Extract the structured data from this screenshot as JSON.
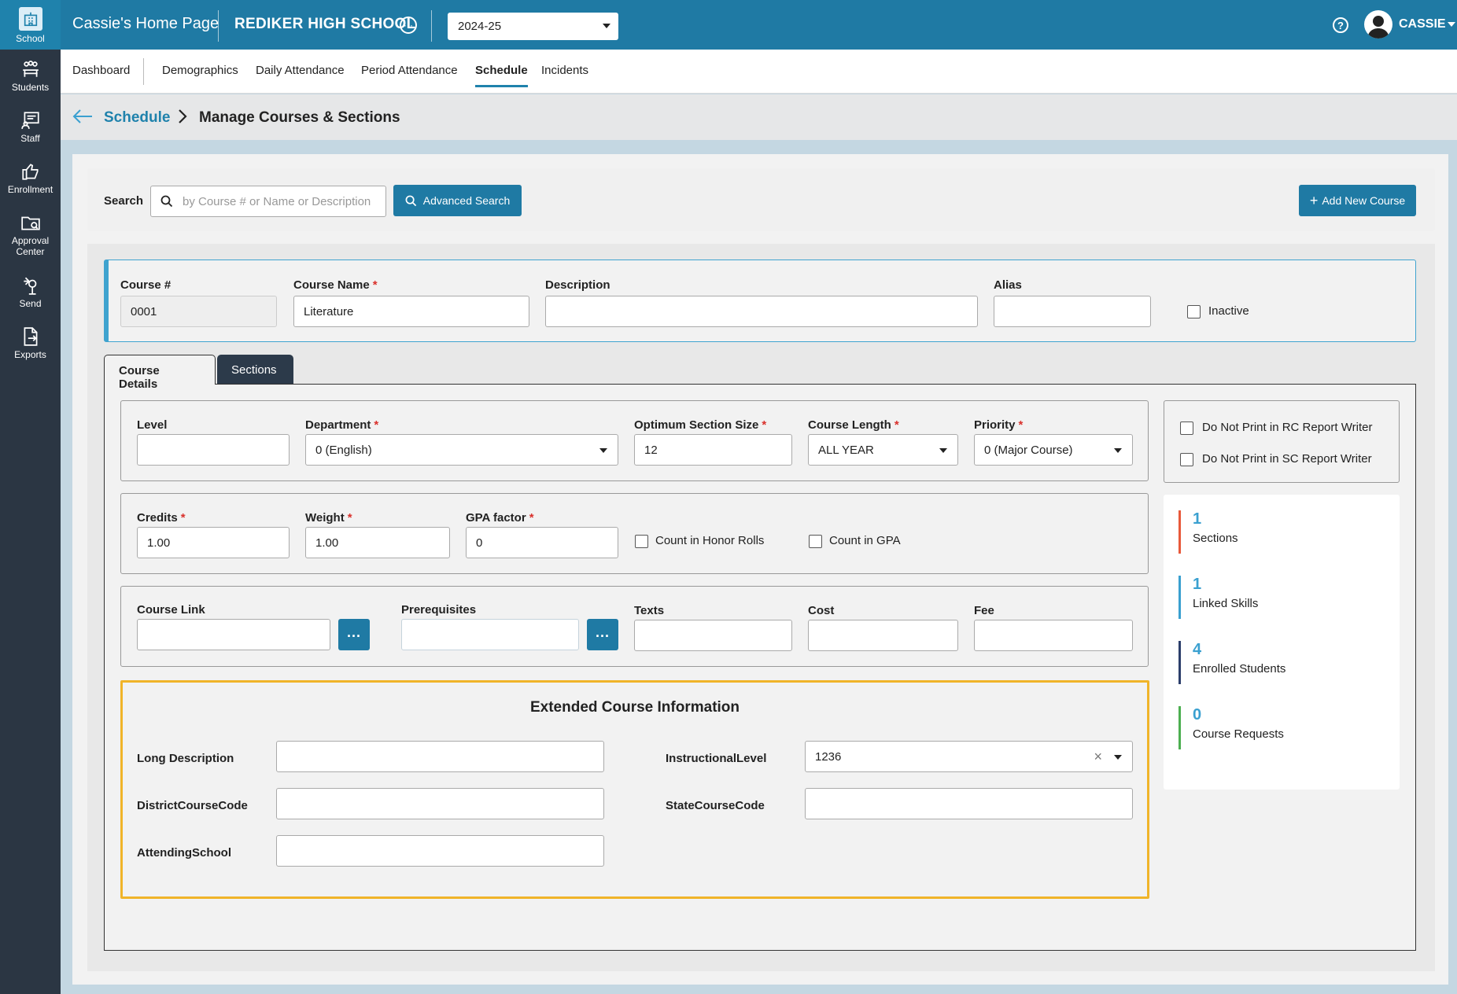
{
  "rail": {
    "items": [
      {
        "label": "School",
        "icon": "school-icon"
      },
      {
        "label": "Students",
        "icon": "students-icon"
      },
      {
        "label": "Staff",
        "icon": "staff-icon"
      },
      {
        "label": "Enrollment",
        "icon": "enrollment-icon"
      },
      {
        "label_line1": "Approval",
        "label_line2": "Center",
        "icon": "approval-folder-icon"
      },
      {
        "label": "Send",
        "icon": "send-icon"
      },
      {
        "label": "Exports",
        "icon": "exports-icon"
      }
    ]
  },
  "topbar": {
    "home_title": "Cassie's Home Page",
    "school_name": "REDIKER HIGH SCHOOL",
    "year": "2024-25",
    "help": "?",
    "user_name": "CASSIE"
  },
  "nav": {
    "tabs": [
      "Dashboard",
      "Demographics",
      "Daily Attendance",
      "Period Attendance",
      "Schedule",
      "Incidents"
    ],
    "active": "Schedule"
  },
  "breadcrumb": {
    "parent": "Schedule",
    "current": "Manage Courses & Sections"
  },
  "search": {
    "label": "Search",
    "placeholder": "by Course # or Name or Description",
    "advanced_button": "Advanced Search",
    "add_button": "Add New Course"
  },
  "course": {
    "number_label": "Course #",
    "number": "0001",
    "name_label": "Course Name",
    "name": "Literature",
    "description_label": "Description",
    "description": "",
    "alias_label": "Alias",
    "alias": "",
    "inactive_label": "Inactive"
  },
  "tabs": {
    "details": "Course Details",
    "sections": "Sections"
  },
  "details": {
    "level_label": "Level",
    "level": "",
    "department_label": "Department",
    "department": "0 (English)",
    "optimum_label": "Optimum Section Size",
    "optimum": "12",
    "length_label": "Course Length",
    "length": "ALL YEAR",
    "priority_label": "Priority",
    "priority": "0 (Major Course)",
    "credits_label": "Credits",
    "credits": "1.00",
    "weight_label": "Weight",
    "weight": "1.00",
    "gpa_factor_label": "GPA factor",
    "gpa_factor": "0",
    "honor_rolls_label": "Count in Honor Rolls",
    "count_gpa_label": "Count in GPA",
    "course_link_label": "Course Link",
    "prereq_label": "Prerequisites",
    "texts_label": "Texts",
    "cost_label": "Cost",
    "fee_label": "Fee",
    "dots": "..."
  },
  "report_options": {
    "rc_label": "Do Not Print in RC Report Writer",
    "sc_label": "Do Not Print in SC Report Writer"
  },
  "stats": [
    {
      "value": "1",
      "label": "Sections",
      "color": "#e8593b"
    },
    {
      "value": "1",
      "label": "Linked Skills",
      "color": "#3aa0d0"
    },
    {
      "value": "4",
      "label": "Enrolled Students",
      "color": "#2c3e6b"
    },
    {
      "value": "0",
      "label": "Course Requests",
      "color": "#4caf50"
    }
  ],
  "extended": {
    "title": "Extended Course Information",
    "long_desc_label": "Long Description",
    "district_code_label": "DistrictCourseCode",
    "attending_label": "AttendingSchool",
    "instructional_label": "InstructionalLevel",
    "instructional_value": "1236",
    "state_code_label": "StateCourseCode"
  },
  "colors": {
    "brand": "#1f7aa4",
    "rail": "#2b3643",
    "highlight": "#f0b429",
    "required": "#d9312c"
  }
}
